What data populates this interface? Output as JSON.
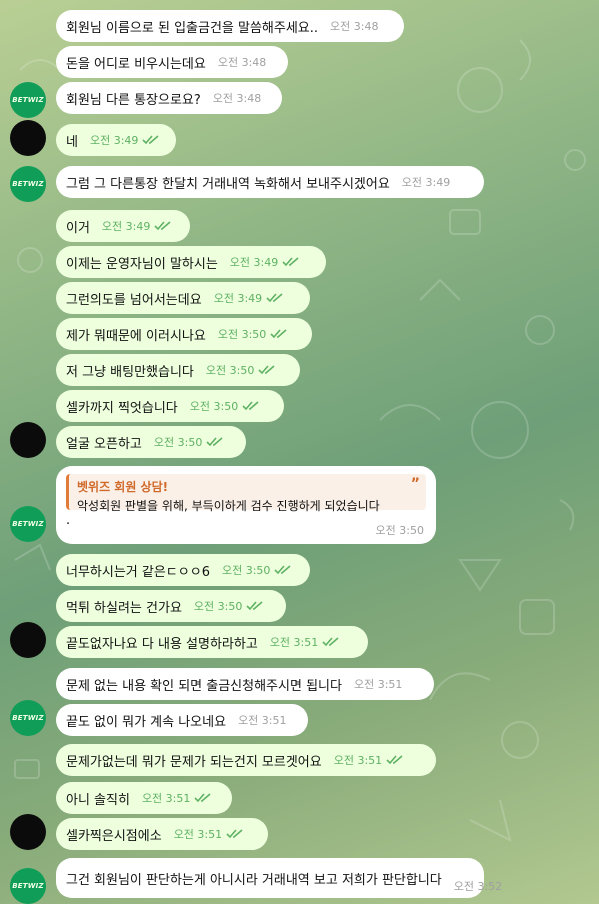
{
  "brand_avatar_text": "BETWIZ",
  "colors": {
    "outgoing_bubble": "#eeffde",
    "incoming_bubble": "#ffffff",
    "read_check": "#5fb163",
    "brand": "#0f9d58",
    "quote_accent": "#e07b39"
  },
  "messages": [
    {
      "text": "회원님 이름으로 된 입출금건을 말씀해주세요..",
      "time": "오전 3:48"
    },
    {
      "text": "돈을 어디로 비우시는데요",
      "time": "오전 3:48"
    },
    {
      "text": "회원님 다른 통장으로요?",
      "time": "오전 3:48"
    },
    {
      "text": "네",
      "time": "오전 3:49"
    },
    {
      "text": "그럼 그 다른통장 한달치 거래내역 녹화해서 보내주시겠어요",
      "time": "오전 3:49"
    },
    {
      "text": "이거",
      "time": "오전 3:49"
    },
    {
      "text": "이제는 운영자님이 말하시는",
      "time": "오전 3:49"
    },
    {
      "text": "그런의도를 넘어서는데요",
      "time": "오전 3:49"
    },
    {
      "text": "제가 뭐때문에 이러시나요",
      "time": "오전 3:50"
    },
    {
      "text": "저 그냥 배팅만했습니다",
      "time": "오전 3:50"
    },
    {
      "text": "셀카까지 찍엇습니다",
      "time": "오전 3:50"
    },
    {
      "text": "얼굴 오픈하고",
      "time": "오전 3:50"
    },
    {
      "quote_title": "벳위즈 회원 상담!",
      "quote_text": "악성회원 판별을 위해, 부득이하게 검수 진행하게 되었습니다",
      "text": ".",
      "time": "오전 3:50"
    },
    {
      "text": "너무하시는거 같은ㄷㅇㅇ6",
      "time": "오전 3:50"
    },
    {
      "text": "먹튀 하실려는 건가요",
      "time": "오전 3:50"
    },
    {
      "text": "끝도없자나요 다 내용 설명하라하고",
      "time": "오전 3:51"
    },
    {
      "text": "문제 없는 내용 확인 되면 출금신청해주시면 됩니다",
      "time": "오전 3:51"
    },
    {
      "text": "끝도 없이 뭐가 계속 나오네요",
      "time": "오전 3:51"
    },
    {
      "text": "문제가없는데 뭐가 문제가 되는건지 모르겟어요",
      "time": "오전 3:51"
    },
    {
      "text": "아니 솔직히",
      "time": "오전 3:51"
    },
    {
      "text": "셀카찍은시점에소",
      "time": "오전 3:51"
    },
    {
      "text": "그건 회원님이 판단하는게 아니시라 거래내역 보고 저희가 판단합니다",
      "time": "오전 3:52"
    }
  ]
}
